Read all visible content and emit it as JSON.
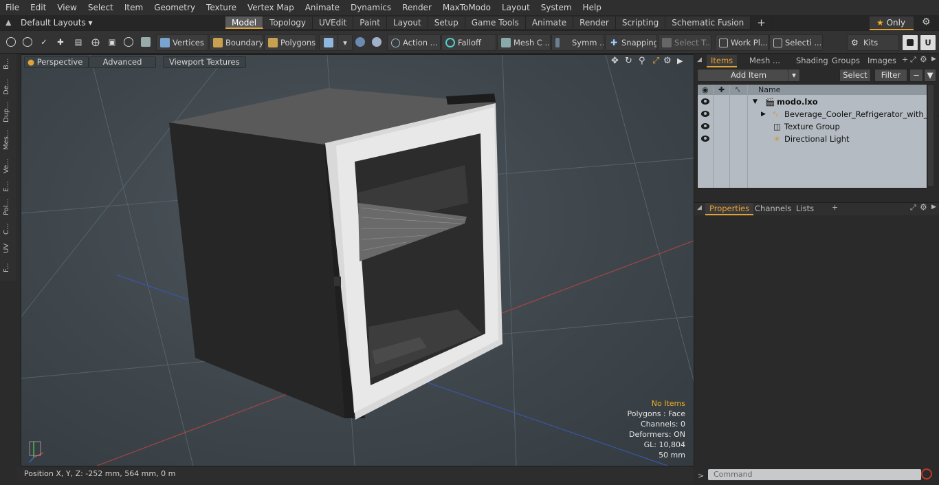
{
  "menu": [
    "File",
    "Edit",
    "View",
    "Select",
    "Item",
    "Geometry",
    "Texture",
    "Vertex Map",
    "Animate",
    "Dynamics",
    "Render",
    "MaxToModo",
    "Layout",
    "System",
    "Help"
  ],
  "layout_selector": "Default Layouts",
  "layout_tabs": [
    "Model",
    "Topology",
    "UVEdit",
    "Paint",
    "Layout",
    "Setup",
    "Game Tools",
    "Animate",
    "Render",
    "Scripting",
    "Schematic Fusion"
  ],
  "active_tab": "Model",
  "only_label": "Only",
  "toolbar": {
    "vertices": "Vertices",
    "boundary": "Boundary",
    "polygons": "Polygons",
    "action": "Action ...",
    "falloff": "Falloff",
    "mesh": "Mesh C ...",
    "symm": "Symm ...",
    "snapping": "Snapping",
    "select_t": "Select T...",
    "work_pl": "Work Pl...",
    "selecti": "Selecti ...",
    "kits": "Kits"
  },
  "left_tabs": [
    "B...",
    "De...",
    "Dup...",
    "Mes...",
    "Ve...",
    "E...",
    "Pol...",
    "C...",
    "UV",
    "F..."
  ],
  "viewport": {
    "perspective": "Perspective",
    "advanced": "Advanced",
    "textures": "Viewport Textures",
    "info": {
      "no_items": "No Items",
      "polygons": "Polygons : Face",
      "channels": "Channels: 0",
      "deformers": "Deformers: ON",
      "gl": "GL: 10,804",
      "scale": "50 mm"
    }
  },
  "status": {
    "position": "Position X, Y, Z:   -252 mm, 564 mm, 0 m"
  },
  "right_panel": {
    "tabs_top": [
      "Items",
      "Mesh ...",
      "Shading",
      "Groups",
      "Images"
    ],
    "add_item": "Add Item",
    "select": "Select",
    "filter": "Filter",
    "name_header": "Name",
    "items": [
      {
        "label": "modo.lxo",
        "bold": true,
        "indent": 0
      },
      {
        "label": "Beverage_Cooler_Refrigerator_with_M ...",
        "bold": false,
        "indent": 1
      },
      {
        "label": "Texture Group",
        "bold": false,
        "indent": 1
      },
      {
        "label": "Directional Light",
        "bold": false,
        "indent": 1
      }
    ],
    "tabs_bottom": [
      "Properties",
      "Channels",
      "Lists"
    ],
    "command_placeholder": "Command"
  }
}
